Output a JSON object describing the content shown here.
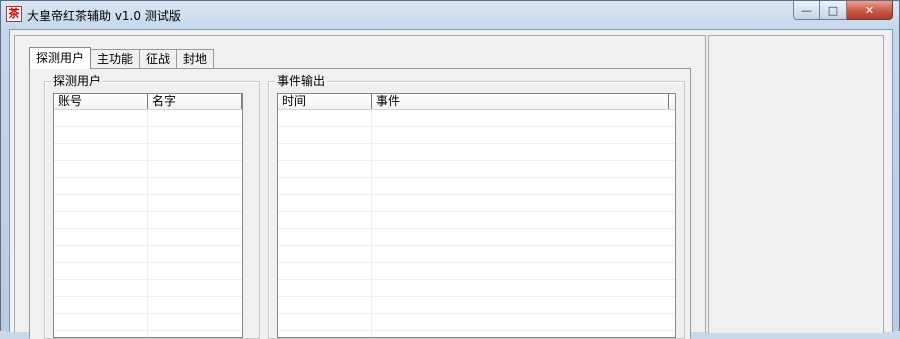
{
  "window": {
    "title": "大皇帝红茶辅助 v1.0 测试版",
    "app_icon_glyph": "茶",
    "minimize_glyph": "—",
    "maximize_glyph": "□",
    "close_glyph": "✕"
  },
  "tabs": [
    {
      "label": "探测用户",
      "active": true
    },
    {
      "label": "主功能",
      "active": false
    },
    {
      "label": "征战",
      "active": false
    },
    {
      "label": "封地",
      "active": false
    }
  ],
  "probe_group": {
    "title": "探测用户",
    "columns": [
      "账号",
      "名字"
    ]
  },
  "event_group": {
    "title": "事件输出",
    "columns": [
      "时间",
      "事件"
    ]
  },
  "colors": {
    "titlebar": "#c4d6ea",
    "close_button": "#c75a48",
    "panel": "#f0f0f0"
  }
}
